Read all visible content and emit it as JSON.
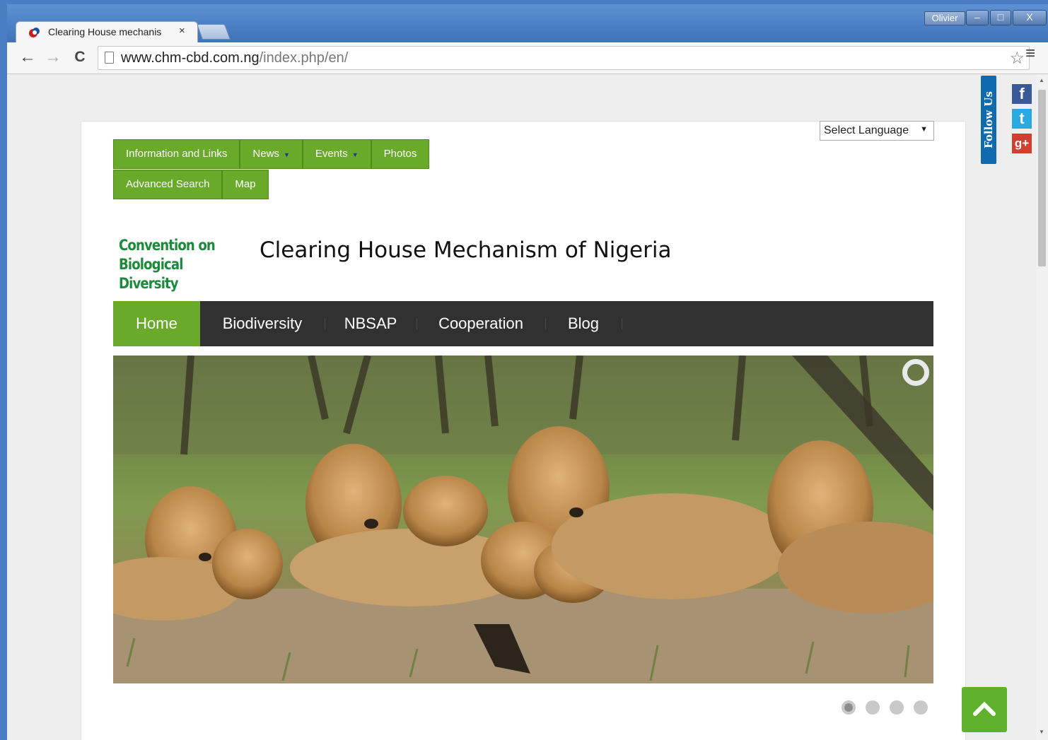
{
  "browser": {
    "user_name": "Olivier",
    "tab_title": "Clearing House mechanis",
    "tab_close": "×",
    "url_host": "www.chm-cbd.com.ng",
    "url_path": "/index.php/en/",
    "back_icon": "←",
    "forward_icon": "→",
    "reload_icon": "C",
    "star_icon": "☆",
    "menu_icon": "≡",
    "min_icon": "–",
    "max_icon": "□",
    "close_icon": "X"
  },
  "page": {
    "language_select": {
      "value": "Select Language",
      "arrow": "▼"
    },
    "top_menu_row1": [
      {
        "label": "Information and Links",
        "has_caret": false
      },
      {
        "label": "News",
        "has_caret": true
      },
      {
        "label": "Events",
        "has_caret": true
      },
      {
        "label": "Photos",
        "has_caret": false
      }
    ],
    "top_menu_row2": [
      {
        "label": "Advanced Search",
        "has_caret": false
      },
      {
        "label": "Map",
        "has_caret": false
      }
    ],
    "caret": "▼",
    "logo_line1": "Convention on",
    "logo_line2": "Biological Diversity",
    "site_title": "Clearing House Mechanism of Nigeria",
    "main_nav": [
      {
        "label": "Home",
        "active": true
      },
      {
        "label": "Biodiversity",
        "active": false
      },
      {
        "label": "NBSAP",
        "active": false
      },
      {
        "label": "Cooperation",
        "active": false
      },
      {
        "label": "Blog",
        "active": false
      }
    ],
    "slider": {
      "dot_count": 4,
      "active_dot": 1
    },
    "follow_us": "Follow Us",
    "social": [
      {
        "name": "facebook",
        "glyph": "f",
        "color": "#3b5998"
      },
      {
        "name": "twitter",
        "glyph": "t",
        "color": "#2aa9e0"
      },
      {
        "name": "google-plus",
        "glyph": "g+",
        "color": "#d23f31"
      }
    ],
    "colors": {
      "green": "#6aaa2a",
      "nav_dark": "#313131",
      "logo_green": "#1b8a3a"
    }
  }
}
